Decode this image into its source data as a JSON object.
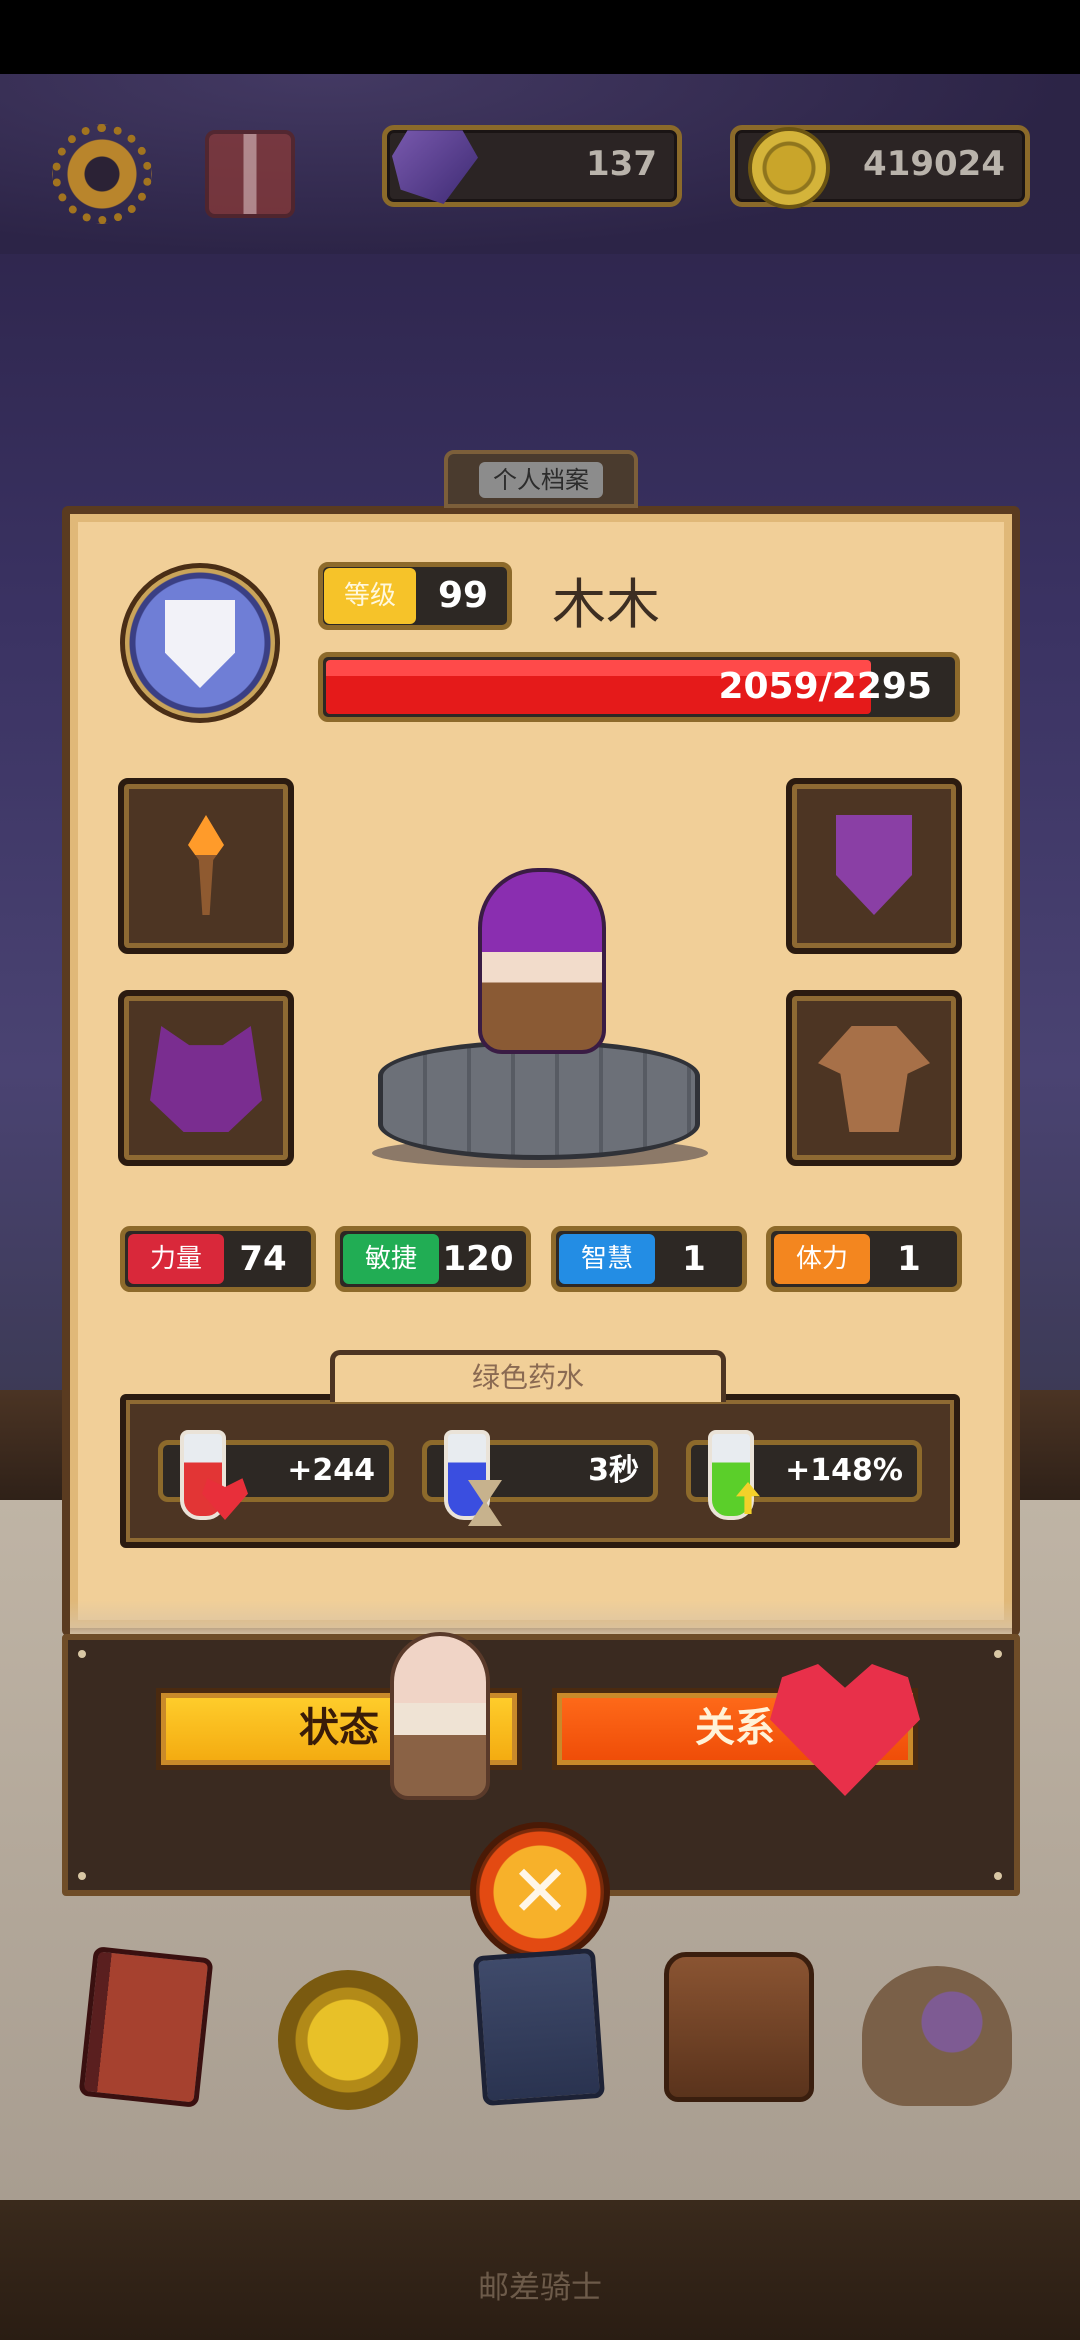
{
  "hud": {
    "gems": "137",
    "coins": "419024"
  },
  "profile": {
    "tab_title": "个人档案",
    "level_label": "等级",
    "level_value": "99",
    "name": "木木",
    "hp_current": 2059,
    "hp_max": 2295,
    "hp_text": "2059/2295"
  },
  "equipment": {
    "weapon": "torch-icon",
    "shield": "shield-icon",
    "helmet": "cat-helmet-icon",
    "armor": "leather-armor-icon"
  },
  "stats": [
    {
      "label": "力量",
      "value": "74",
      "color": "#d9283a"
    },
    {
      "label": "敏捷",
      "value": "120",
      "color": "#21ad54"
    },
    {
      "label": "智慧",
      "value": "1",
      "color": "#238de4"
    },
    {
      "label": "体力",
      "value": "1",
      "color": "#f3861f"
    }
  ],
  "potions": {
    "title": "绿色药水",
    "items": [
      {
        "icon": "red-potion-icon",
        "value": "+244"
      },
      {
        "icon": "blue-potion-icon",
        "value": "3秒"
      },
      {
        "icon": "green-potion-icon",
        "value": "+148%"
      }
    ]
  },
  "tabs": {
    "status": "状态",
    "relation": "关系"
  },
  "close_symbol": "✕",
  "footer": {
    "title": "邮差骑士"
  }
}
